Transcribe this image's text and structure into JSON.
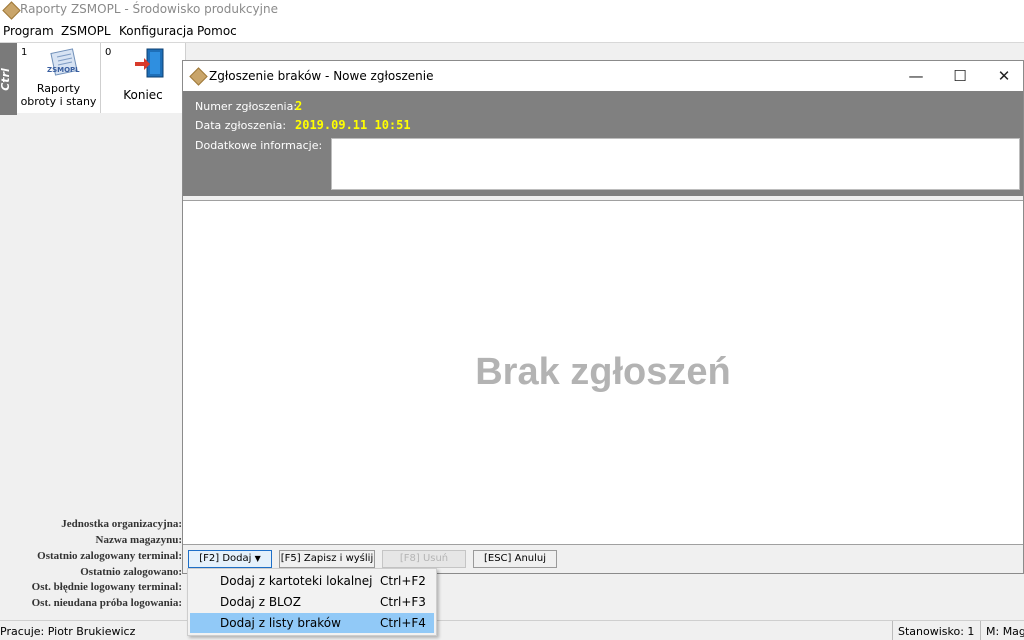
{
  "app": {
    "title": "Raporty ZSMOPL - Środowisko produkcyjne"
  },
  "menu": {
    "items": [
      {
        "label": "Program"
      },
      {
        "label": "ZSMOPL"
      },
      {
        "label": "Konfiguracja"
      },
      {
        "label": "Pomoc"
      }
    ]
  },
  "toolbar": {
    "ctrl_label": "Ctrl",
    "tools": [
      {
        "number": "1",
        "label_line1": "Raporty",
        "label_line2": "obroty i stany",
        "icon": "report-icon",
        "badge": "ZSMOPL"
      },
      {
        "number": "0",
        "label": "Koniec",
        "icon": "exit-door-icon"
      }
    ]
  },
  "session_info": {
    "labels": [
      "Jednostka organizacyjna:",
      "Nazwa magazynu:",
      "Ostatnio zalogowany terminal:",
      "Ostatnio zalogowano:",
      "Ost. błędnie logowany terminal:",
      "Ost. nieudana próba logowania:"
    ]
  },
  "statusbar": {
    "user": "Pracuje: Piotr Brukiewicz",
    "station": "Stanowisko: 1",
    "warehouse": "M: Mag"
  },
  "dialog": {
    "title": "Zgłoszenie braków - Nowe zgłoszenie",
    "controls": {
      "minimize": "—",
      "maximize": "☐",
      "close": "✕"
    },
    "fields": {
      "number_label": "Numer zgłoszenia:",
      "number_value": "2",
      "date_label": "Data zgłoszenia:",
      "date_value": "2019.09.11 10:51",
      "info_label": "Dodatkowe informacje:",
      "info_value": ""
    },
    "empty_message": "Brak zgłoszeń",
    "buttons": {
      "add": "[F2] Dodaj",
      "save": "[F5] Zapisz i wyślij",
      "delete": "[F8] Usuń",
      "cancel": "[ESC] Anuluj"
    }
  },
  "dropdown": {
    "items": [
      {
        "label": "Dodaj z kartoteki lokalnej",
        "shortcut": "Ctrl+F2"
      },
      {
        "label": "Dodaj z BLOZ",
        "shortcut": "Ctrl+F3"
      },
      {
        "label": "Dodaj z listy braków",
        "shortcut": "Ctrl+F4",
        "selected": true
      }
    ]
  },
  "colors": {
    "header_bg": "#808080",
    "value_highlight": "#ffff00",
    "selected_menu": "#91c9f7"
  }
}
